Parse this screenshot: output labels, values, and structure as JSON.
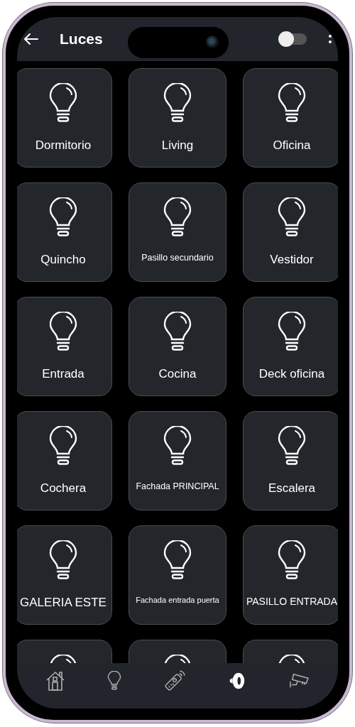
{
  "header": {
    "title": "Luces",
    "toggle": {
      "on": false
    }
  },
  "lights": [
    {
      "kind": "light",
      "label": "Dormitorio"
    },
    {
      "kind": "light",
      "label": "Living"
    },
    {
      "kind": "light",
      "label": "Oficina"
    },
    {
      "kind": "light",
      "label": "Quincho"
    },
    {
      "kind": "light",
      "label": "Pasillo secundario"
    },
    {
      "kind": "light",
      "label": "Vestidor"
    },
    {
      "kind": "light",
      "label": "Entrada"
    },
    {
      "kind": "light",
      "label": "Cocina"
    },
    {
      "kind": "light",
      "label": "Deck oficina"
    },
    {
      "kind": "light",
      "label": "Cochera"
    },
    {
      "kind": "light",
      "label": "Fachada PRINCIPAL"
    },
    {
      "kind": "light",
      "label": "Escalera"
    },
    {
      "kind": "light",
      "label": "GALERIA ESTE"
    },
    {
      "kind": "light",
      "label": "Fachada entrada puerta"
    },
    {
      "kind": "light",
      "label": "PASILLO ENTRADA"
    },
    {
      "kind": "light"
    },
    {
      "kind": "light"
    },
    {
      "kind": "light"
    }
  ],
  "nav": [
    {
      "kind": "home",
      "selected": false
    },
    {
      "kind": "bulb",
      "selected": false
    },
    {
      "kind": "remote",
      "selected": false
    },
    {
      "kind": "doorbell",
      "selected": true
    },
    {
      "kind": "camera",
      "selected": false
    }
  ]
}
